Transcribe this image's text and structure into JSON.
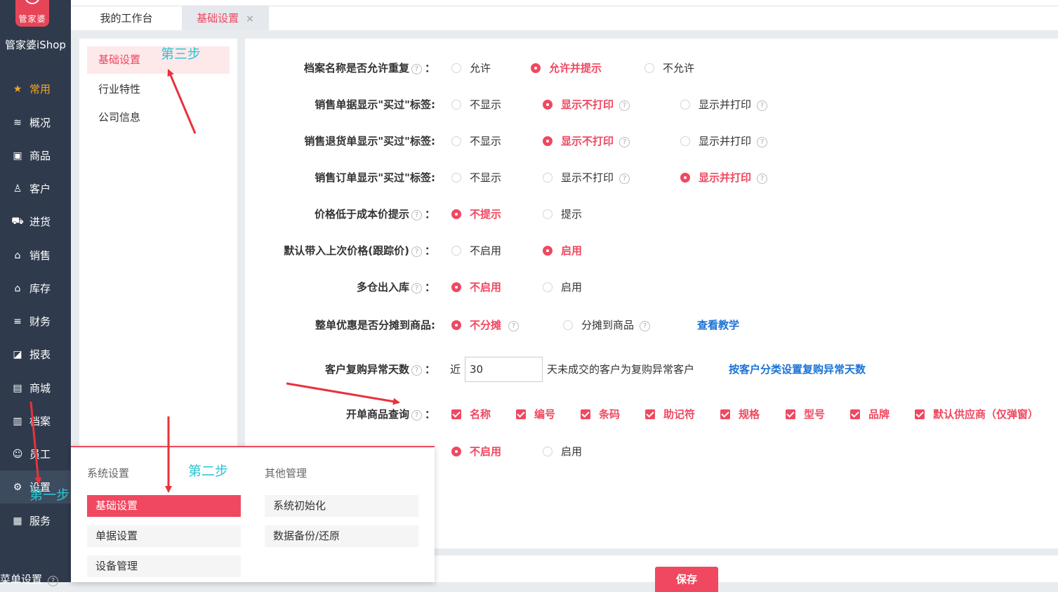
{
  "app": {
    "logo_text": "管家婆",
    "brand": "管家婆iShop"
  },
  "nav": {
    "items": [
      {
        "label": "常用",
        "icon": "star-icon"
      },
      {
        "label": "概况",
        "icon": "layers-icon"
      },
      {
        "label": "商品",
        "icon": "box-icon"
      },
      {
        "label": "客户",
        "icon": "user-icon"
      },
      {
        "label": "进货",
        "icon": "cart-icon"
      },
      {
        "label": "销售",
        "icon": "basket-icon"
      },
      {
        "label": "库存",
        "icon": "warehouse-icon"
      },
      {
        "label": "财务",
        "icon": "coins-icon"
      },
      {
        "label": "报表",
        "icon": "chart-icon"
      },
      {
        "label": "商城",
        "icon": "store-icon"
      },
      {
        "label": "档案",
        "icon": "archive-icon"
      },
      {
        "label": "员工",
        "icon": "staff-icon"
      },
      {
        "label": "设置",
        "icon": "gear-icon"
      },
      {
        "label": "服务",
        "icon": "grid-icon"
      }
    ],
    "footer": "菜单设置"
  },
  "tabs": {
    "home": "我的工作台",
    "basic": "基础设置",
    "close": "×"
  },
  "submenu": {
    "items": [
      "基础设置",
      "行业特性",
      "公司信息"
    ]
  },
  "settings": {
    "help": "?",
    "colon": "：",
    "rows": [
      {
        "label": "档案名称是否允许重复",
        "options": [
          "允许",
          "允许并提示",
          "不允许"
        ]
      },
      {
        "label": "销售单据显示\"买过\"标签:",
        "options": [
          "不显示",
          "显示不打印",
          "显示并打印"
        ]
      },
      {
        "label": "销售退货单显示\"买过\"标签:",
        "options": [
          "不显示",
          "显示不打印",
          "显示并打印"
        ]
      },
      {
        "label": "销售订单显示\"买过\"标签:",
        "options": [
          "不显示",
          "显示不打印",
          "显示并打印"
        ]
      },
      {
        "label": "价格低于成本价提示",
        "options": [
          "不提示",
          "提示"
        ]
      },
      {
        "label": "默认带入上次价格(跟踪价)",
        "options": [
          "不启用",
          "启用"
        ]
      },
      {
        "label": "多仓出入库",
        "options": [
          "不启用",
          "启用"
        ]
      },
      {
        "label": "整单优惠是否分摊到商品:",
        "options": [
          "不分摊",
          "分摊到商品"
        ],
        "link": "查看教学"
      },
      {
        "label": "客户复购异常天数",
        "prefix": "近",
        "value": "30",
        "suffix": "天未成交的客户为复购异常客户",
        "link": "按客户分类设置复购异常天数"
      },
      {
        "label": "开单商品查询",
        "checks": [
          "名称",
          "编号",
          "条码",
          "助记符",
          "规格",
          "型号",
          "品牌",
          "默认供应商（仅弹窗）"
        ]
      },
      {
        "options": [
          "不启用",
          "启用"
        ]
      }
    ]
  },
  "save_label": "保存",
  "popup": {
    "col1_title": "系统设置",
    "col2_title": "其他管理",
    "col1": [
      "基础设置",
      "单据设置",
      "设备管理"
    ],
    "col2": [
      "系统初始化",
      "数据备份/还原"
    ]
  },
  "annotations": {
    "step1": "第一步",
    "step2": "第二步",
    "step3": "第三步"
  },
  "colors": {
    "accent": "#f04860",
    "nav_bg": "#2f3b4d",
    "link": "#1a73d6",
    "annotation": "#2ec4d0",
    "arrow": "#e8323c"
  }
}
